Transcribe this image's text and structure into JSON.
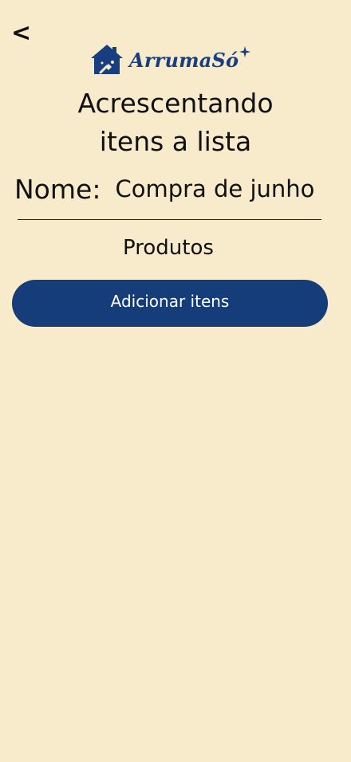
{
  "header": {
    "back_label": "<",
    "logo_text": "ArrumaSó",
    "logo_icon": "house-cleaning-icon",
    "brand_color": "#173e7f"
  },
  "page": {
    "title_line1": "Acrescentando",
    "title_line2": "itens a lista"
  },
  "list": {
    "name_label": "Nome:",
    "name_value": "Compra de junho",
    "products_heading": "Produtos"
  },
  "actions": {
    "add_items_label": "Adicionar itens",
    "button_color": "#153d79"
  },
  "theme": {
    "background": "#f8ebcc"
  }
}
